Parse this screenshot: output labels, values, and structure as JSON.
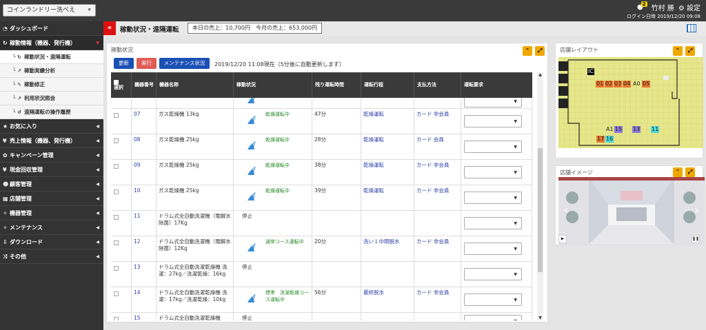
{
  "header": {
    "store_name": "コインランドリー洗べえ",
    "user_name": "竹村 勝",
    "notification_count": "2",
    "settings_label": "設定",
    "login_label": "ログイン日時 2019/12/20 09:08"
  },
  "sidebar": {
    "items": [
      {
        "label": "ダッシュボード",
        "icon": "dashboard-icon"
      },
      {
        "label": "稼動情報（機器、発行機）",
        "icon": "refresh-icon"
      },
      {
        "label": "お気に入り",
        "icon": "star-icon"
      },
      {
        "label": "売上情報（機器、発行機）",
        "icon": "yen-icon"
      },
      {
        "label": "キャンペーン管理",
        "icon": "gift-icon"
      },
      {
        "label": "現金回収管理",
        "icon": "yen-icon"
      },
      {
        "label": "顧客管理",
        "icon": "users-icon"
      },
      {
        "label": "店舗管理",
        "icon": "store-icon"
      },
      {
        "label": "機器管理",
        "icon": "wrench-icon"
      },
      {
        "label": "メンテナンス",
        "icon": "wrench-icon"
      },
      {
        "label": "ダウンロード",
        "icon": "download-icon"
      },
      {
        "label": "その他",
        "icon": "shuffle-icon"
      }
    ],
    "subitems": [
      {
        "label": "稼動状況・遠隔運転"
      },
      {
        "label": "稼動実績分析"
      },
      {
        "label": "稼動修正"
      },
      {
        "label": "利用状況照会"
      },
      {
        "label": "遠隔運転の操作履歴"
      }
    ]
  },
  "page": {
    "title": "稼動状況・遠隔運転",
    "sales": "本日の売上：10,700円　今月の売上：653,000円"
  },
  "main": {
    "panel_title": "稼動状況",
    "buttons": {
      "update": "更新",
      "execute": "実行",
      "maintenance": "メンテナンス状況"
    },
    "timestamp": "2019/12/20 11:08現在（5分後に自動更新します）",
    "columns": {
      "select": "選択",
      "number": "機器番号",
      "name": "機器名称",
      "status": "稼動状況",
      "remaining": "残り運転時間",
      "process": "運転行程",
      "payment": "支払方法",
      "request": "運転要求"
    },
    "rows": [
      {
        "no": "",
        "name": "",
        "status": "",
        "remain": "",
        "process": "",
        "payment": ""
      },
      {
        "no": "07",
        "name": "ガス乾燥機 13kg",
        "status": "乾燥運転中",
        "remain": "47分",
        "process": "乾燥運転",
        "payment": "カード 非会員"
      },
      {
        "no": "08",
        "name": "ガス乾燥機 25kg",
        "status": "乾燥運転中",
        "remain": "28分",
        "process": "乾燥運転",
        "payment": "カード 会員"
      },
      {
        "no": "09",
        "name": "ガス乾燥機 25kg",
        "status": "乾燥運転中",
        "remain": "38分",
        "process": "乾燥運転",
        "payment": "カード 非会員"
      },
      {
        "no": "10",
        "name": "ガス乾燥機 25kg",
        "status": "乾燥運転中",
        "remain": "39分",
        "process": "乾燥運転",
        "payment": "カード 非会員"
      },
      {
        "no": "11",
        "name": "ドラム式全自動洗濯機（電解水除菌）17Kg",
        "status": "停止",
        "remain": "",
        "process": "",
        "payment": ""
      },
      {
        "no": "12",
        "name": "ドラム式全自動洗濯機（電解水除菌）12Kg",
        "status": "通常コース運転中",
        "remain": "20分",
        "process": "洗い１中間脱水",
        "payment": "カード 非会員"
      },
      {
        "no": "13",
        "name": "ドラム式全自動洗濯乾燥機 洗濯：27kg／洗濯乾燥：16kg",
        "status": "停止",
        "remain": "",
        "process": "",
        "payment": ""
      },
      {
        "no": "14",
        "name": "ドラム式全自動洗濯乾燥機 洗濯：17kg／洗濯乾燥：10kg",
        "status": "標準　洗濯乾燥コース運転中",
        "remain": "56分",
        "process": "最終脱水",
        "payment": "カード 非会員"
      },
      {
        "no": "15",
        "name": "ドラム式全自動洗濯乾燥機",
        "status": "停止",
        "remain": "",
        "process": "",
        "payment": ""
      }
    ]
  },
  "layout_panel": {
    "title": "店舗レイアウト",
    "labels": [
      "IC",
      "01",
      "02",
      "03",
      "04",
      "A0",
      "05",
      "A1",
      "15",
      "13",
      "11",
      "17",
      "16"
    ]
  },
  "image_panel": {
    "title": "店舗イメージ"
  },
  "colors": {
    "accent": "#f0a800",
    "header_bg": "#3a3a3a",
    "link": "#2a3da8",
    "running": "#2a8a2a"
  }
}
